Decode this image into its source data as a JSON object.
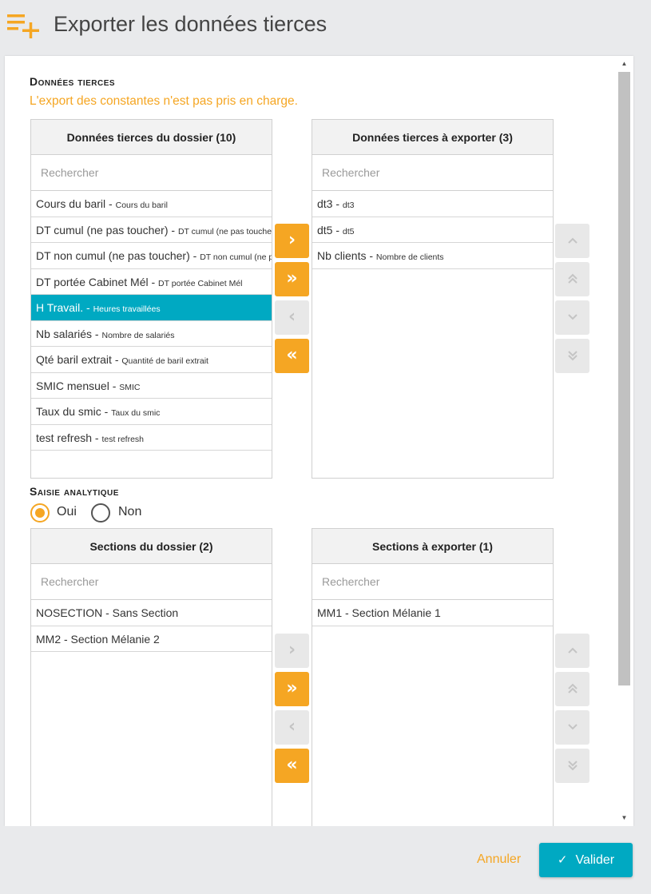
{
  "header": {
    "title": "Exporter les données tierces",
    "icon": "playlist-add-icon"
  },
  "colors": {
    "accent": "#f5a623",
    "primary": "#00a9c2",
    "selected_row": "#00a9c2"
  },
  "donnees": {
    "section_title": "Données tierces",
    "warning": "L'export des constantes n'est pas pris en charge.",
    "left": {
      "header": "Données tierces du dossier (10)",
      "search_placeholder": "Rechercher",
      "rows": [
        {
          "main": "Cours du baril",
          "sub": "Cours du baril",
          "selected": false
        },
        {
          "main": "DT cumul (ne pas toucher)",
          "sub": "DT cumul (ne pas toucher)",
          "selected": false
        },
        {
          "main": "DT non cumul (ne pas toucher)",
          "sub": "DT non cumul (ne pas toucher)",
          "selected": false
        },
        {
          "main": "DT portée Cabinet Mél",
          "sub": "DT portée Cabinet Mél",
          "selected": false
        },
        {
          "main": "H Travail.",
          "sub": "Heures travaillées",
          "selected": true
        },
        {
          "main": "Nb salariés",
          "sub": "Nombre de salariés",
          "selected": false
        },
        {
          "main": "Qté baril extrait",
          "sub": "Quantité de baril extrait",
          "selected": false
        },
        {
          "main": "SMIC mensuel",
          "sub": "SMIC",
          "selected": false
        },
        {
          "main": "Taux du smic",
          "sub": "Taux du smic",
          "selected": false
        },
        {
          "main": "test refresh",
          "sub": "test refresh",
          "selected": false
        }
      ]
    },
    "right": {
      "header": "Données tierces à exporter (3)",
      "search_placeholder": "Rechercher",
      "rows": [
        {
          "main": "dt3",
          "sub": "dt3"
        },
        {
          "main": "dt5",
          "sub": "dt5"
        },
        {
          "main": "Nb clients",
          "sub": "Nombre de clients"
        }
      ]
    },
    "transfer_buttons": [
      {
        "symbol": "›",
        "state": "active"
      },
      {
        "symbol": "»",
        "state": "active"
      },
      {
        "symbol": "‹",
        "state": "disabled"
      },
      {
        "symbol": "«",
        "state": "active"
      }
    ],
    "order_buttons": [
      {
        "symbol": "⌃",
        "state": "disabled"
      },
      {
        "symbol": "⏶",
        "state": "disabled"
      },
      {
        "symbol": "⌄",
        "state": "disabled"
      },
      {
        "symbol": "⏷",
        "state": "disabled"
      }
    ]
  },
  "analytique": {
    "section_title": "Saisie analytique",
    "options": [
      {
        "label": "Oui",
        "checked": true
      },
      {
        "label": "Non",
        "checked": false
      }
    ],
    "left": {
      "header": "Sections du dossier (2)",
      "search_placeholder": "Rechercher",
      "rows": [
        {
          "main": "NOSECTION - Sans Section"
        },
        {
          "main": "MM2 - Section Mélanie 2"
        }
      ]
    },
    "right": {
      "header": "Sections à exporter (1)",
      "search_placeholder": "Rechercher",
      "rows": [
        {
          "main": "MM1 - Section Mélanie 1"
        }
      ]
    },
    "transfer_buttons": [
      {
        "symbol": "›",
        "state": "disabled"
      },
      {
        "symbol": "»",
        "state": "active"
      },
      {
        "symbol": "‹",
        "state": "disabled"
      },
      {
        "symbol": "«",
        "state": "active"
      }
    ]
  },
  "footer": {
    "cancel": "Annuler",
    "ok": "Valider"
  }
}
